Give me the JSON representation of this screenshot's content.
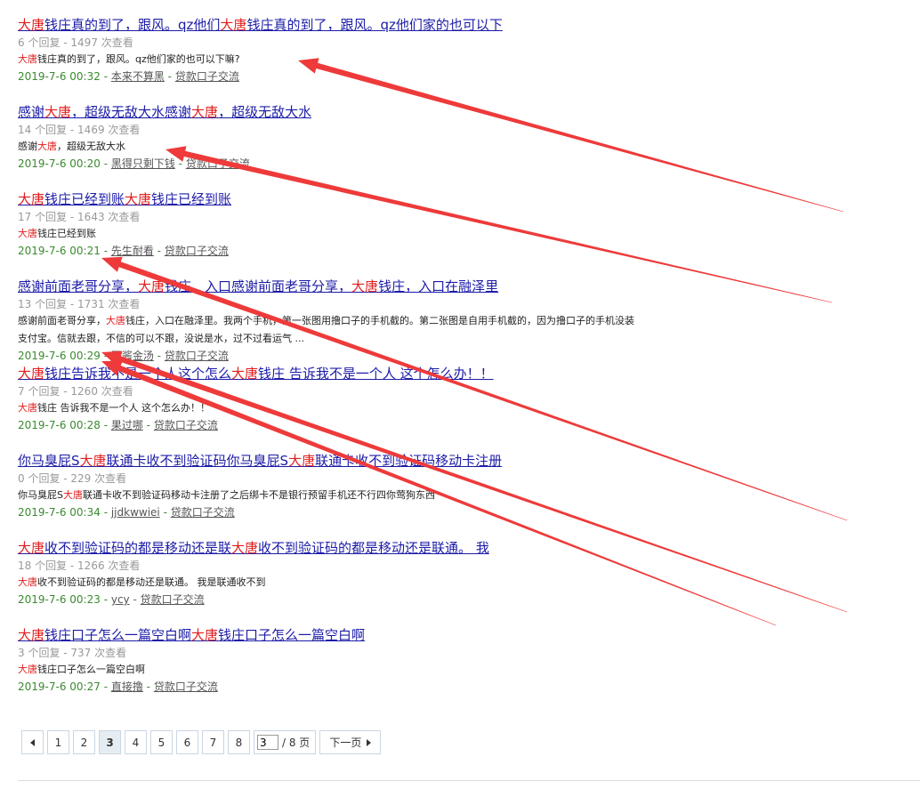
{
  "results": [
    {
      "title": [
        {
          "t": "大唐",
          "hl": true
        },
        {
          "t": "钱庄真的到了，跟风。qz他们"
        },
        {
          "t": "大唐",
          "hl": true
        },
        {
          "t": "钱庄真的到了，跟风。qz他们家的也可以下"
        }
      ],
      "stats": "6 个回复 - 1497 次查看",
      "snippet": [
        {
          "t": "大唐",
          "hl": true
        },
        {
          "t": "钱庄真的到了，跟风。qz他们家的也可以下嘛?"
        }
      ],
      "date": "2019-7-6 00:32",
      "author": "本来不算黑",
      "forum": "贷款口子交流"
    },
    {
      "title": [
        {
          "t": "感谢"
        },
        {
          "t": "大唐",
          "hl": true
        },
        {
          "t": "，超级无敌大水感谢"
        },
        {
          "t": "大唐",
          "hl": true
        },
        {
          "t": "，超级无敌大水"
        }
      ],
      "stats": "14 个回复 - 1469 次查看",
      "snippet": [
        {
          "t": "感谢"
        },
        {
          "t": "大唐",
          "hl": true
        },
        {
          "t": "，超级无敌大水"
        }
      ],
      "date": "2019-7-6 00:20",
      "author": "黑得只剩下钱",
      "forum": "贷款口子交流"
    },
    {
      "title": [
        {
          "t": "大唐",
          "hl": true
        },
        {
          "t": "钱庄已经到账"
        },
        {
          "t": "大唐",
          "hl": true
        },
        {
          "t": "钱庄已经到账"
        }
      ],
      "stats": "17 个回复 - 1643 次查看",
      "snippet": [
        {
          "t": "大唐",
          "hl": true
        },
        {
          "t": "钱庄已经到账"
        }
      ],
      "date": "2019-7-6 00:21",
      "author": "先生耐看",
      "forum": "贷款口子交流"
    },
    {
      "title": [
        {
          "t": "感谢前面老哥分享，"
        },
        {
          "t": "大唐",
          "hl": true
        },
        {
          "t": "钱庄，入口感谢前面老哥分享，"
        },
        {
          "t": "大唐",
          "hl": true
        },
        {
          "t": "钱庄，入口在融泽里"
        }
      ],
      "stats": "13 个回复 - 1731 次查看",
      "snippet": [
        {
          "t": "感谢前面老哥分享，"
        },
        {
          "t": "大唐",
          "hl": true
        },
        {
          "t": "钱庄，入口在融泽里。我两个手机，第一张图用撸口子的手机截的。第二张图是自用手机截的，因为撸口子的手机没装\n支付宝。信就去跟，不信的可以不跟，没说是水，过不过看运气 ..."
        }
      ],
      "date": "2019-7-6 00:29",
      "author": "国酱金汤",
      "forum": "贷款口子交流"
    },
    {
      "title": [
        {
          "t": "大唐",
          "hl": true
        },
        {
          "t": "钱庄告诉我不是一个人这个怎么"
        },
        {
          "t": "大唐",
          "hl": true
        },
        {
          "t": "钱庄 告诉我不是一个人 这个怎么办！！"
        }
      ],
      "stats": "7 个回复 - 1260 次查看",
      "snippet": [
        {
          "t": "大唐",
          "hl": true
        },
        {
          "t": "钱庄 告诉我不是一个人 这个怎么办！！"
        }
      ],
      "date": "2019-7-6 00:28",
      "author": "果过哪",
      "forum": "贷款口子交流"
    },
    {
      "title": [
        {
          "t": "你马臭屁S"
        },
        {
          "t": "大唐",
          "hl": true
        },
        {
          "t": "联通卡收不到验证码你马臭屁S"
        },
        {
          "t": "大唐",
          "hl": true
        },
        {
          "t": "联通卡收不到验证码移动卡注册"
        }
      ],
      "stats": "0 个回复 - 229 次查看",
      "snippet": [
        {
          "t": "你马臭屁S"
        },
        {
          "t": "大唐",
          "hl": true
        },
        {
          "t": "联通卡收不到验证码移动卡注册了之后绑卡不是银行预留手机还不行四你莺狗东西"
        }
      ],
      "date": "2019-7-6 00:34",
      "author": "jjdkwwiei",
      "forum": "贷款口子交流"
    },
    {
      "title": [
        {
          "t": "大唐",
          "hl": true
        },
        {
          "t": "收不到验证码的都是移动还是联"
        },
        {
          "t": "大唐",
          "hl": true
        },
        {
          "t": "收不到验证码的都是移动还是联通。 我"
        }
      ],
      "stats": "18 个回复 - 1266 次查看",
      "snippet": [
        {
          "t": "大唐",
          "hl": true
        },
        {
          "t": "收不到验证码的都是移动还是联通。 我是联通收不到"
        }
      ],
      "date": "2019-7-6 00:23",
      "author": "ycy",
      "forum": "贷款口子交流"
    },
    {
      "title": [
        {
          "t": "大唐",
          "hl": true
        },
        {
          "t": "钱庄口子怎么一篇空白啊"
        },
        {
          "t": "大唐",
          "hl": true
        },
        {
          "t": "钱庄口子怎么一篇空白啊"
        }
      ],
      "stats": "3 个回复 - 737 次查看",
      "snippet": [
        {
          "t": "大唐",
          "hl": true
        },
        {
          "t": "钱庄口子怎么一篇空白啊"
        }
      ],
      "date": "2019-7-6 00:27",
      "author": "直接撸",
      "forum": "贷款口子交流"
    }
  ],
  "meta_separator": " - ",
  "pager": {
    "pages": [
      "1",
      "2",
      "3",
      "4",
      "5",
      "6",
      "7",
      "8"
    ],
    "current": "3",
    "jump_value": "3",
    "jump_suffix": "/ 8 页",
    "next_label": "下一页"
  },
  "colors": {
    "highlight": "#e21e1e",
    "title_link": "#1c1ca8",
    "meta_date": "#3a8a2f",
    "annotation_arrow": "#ee3a3a"
  },
  "annotations": [
    {
      "name": "arrow-to-result-1-snippet",
      "target": "result-1-snippet"
    },
    {
      "name": "arrow-to-result-2-snippet",
      "target": "result-2-snippet"
    },
    {
      "name": "arrow-to-result-3-date",
      "target": "result-3-date"
    },
    {
      "name": "arrow-to-result-4-meta",
      "target": "result-4-meta"
    },
    {
      "name": "arrow-to-result-4-author",
      "target": "result-4-author"
    }
  ]
}
